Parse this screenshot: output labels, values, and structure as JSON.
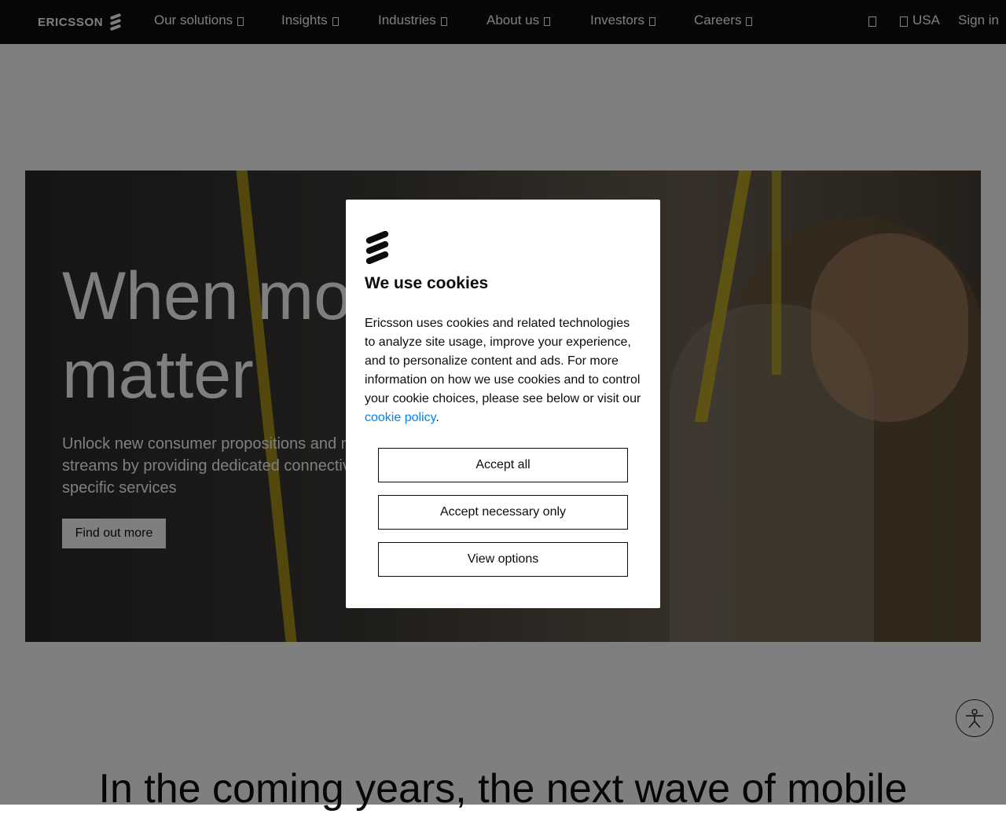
{
  "nav": {
    "logo_text": "ERICSSON",
    "items": [
      {
        "label": "Our solutions"
      },
      {
        "label": "Insights"
      },
      {
        "label": "Industries"
      },
      {
        "label": "About us"
      },
      {
        "label": "Investors"
      },
      {
        "label": "Careers"
      }
    ],
    "region_label": "USA",
    "sign_in": "Sign in"
  },
  "hero": {
    "title_line1": "When mo",
    "title_line2": "matter",
    "description": "Unlock new consumer propositions and n streams by providing dedicated connectiv specific services",
    "cta": "Find out more"
  },
  "subheading": "In the coming years, the next wave of mobile",
  "cookie_modal": {
    "title": "We use cookies",
    "body": "Ericsson uses cookies and related technologies to analyze site usage, improve your experience, and to personalize content and ads. For more information on how we use cookies and to control your cookie choices, please see below or visit our",
    "link_text": "cookie policy",
    "period": ".",
    "buttons": {
      "accept_all": "Accept all",
      "accept_necessary": "Accept necessary only",
      "view_options": "View options"
    }
  },
  "colors": {
    "nav_bg": "#0c0c0c",
    "link": "#0082f0",
    "overlay": "rgba(0,0,0,0.5)"
  },
  "icons": [
    "ericsson-logo-icon",
    "chevron-down-icon",
    "search-icon",
    "globe-icon",
    "accessibility-icon"
  ]
}
